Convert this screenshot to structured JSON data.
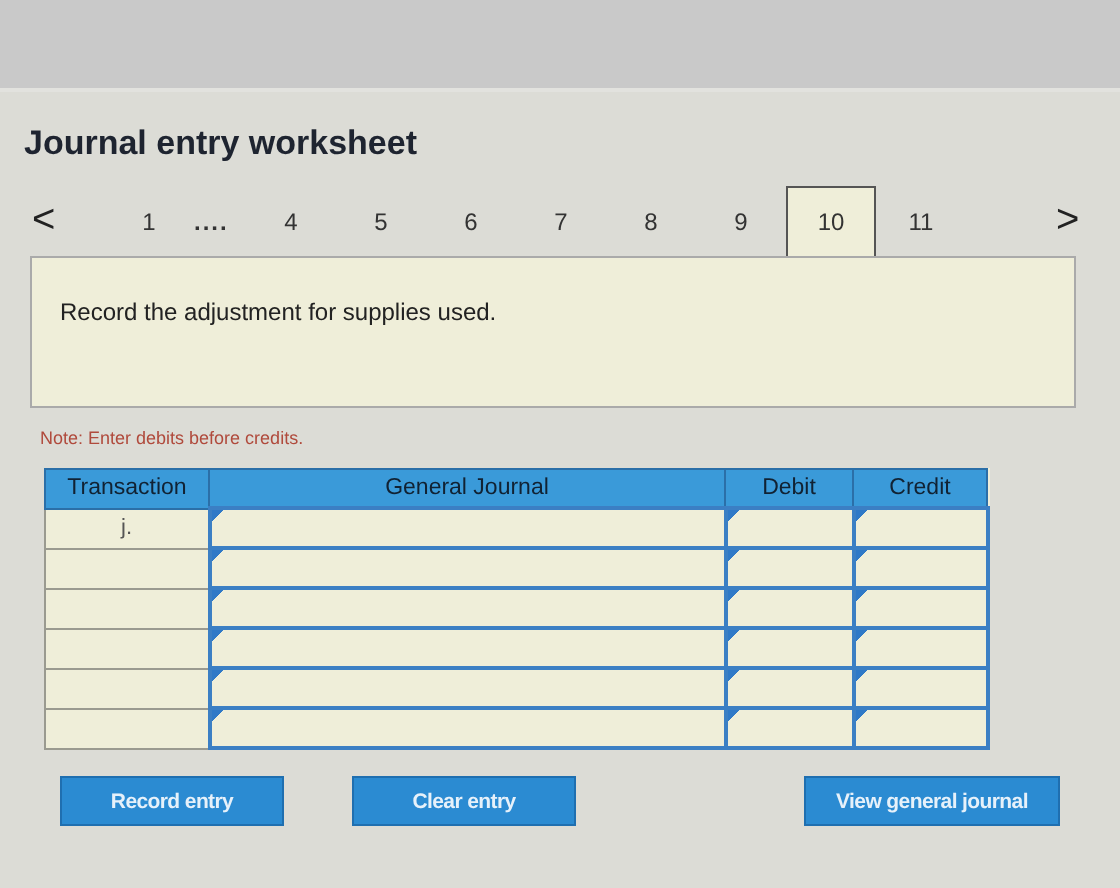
{
  "title": "Journal entry worksheet",
  "nav": {
    "prev": "<",
    "next": ">"
  },
  "tabs": [
    {
      "kind": "tab",
      "label": "1",
      "selected": false
    },
    {
      "kind": "ellipsis",
      "label": "....",
      "selected": false
    },
    {
      "kind": "tab",
      "label": "4",
      "selected": false
    },
    {
      "kind": "tab",
      "label": "5",
      "selected": false
    },
    {
      "kind": "tab",
      "label": "6",
      "selected": false
    },
    {
      "kind": "tab",
      "label": "7",
      "selected": false
    },
    {
      "kind": "tab",
      "label": "8",
      "selected": false
    },
    {
      "kind": "tab",
      "label": "9",
      "selected": false
    },
    {
      "kind": "tab",
      "label": "10",
      "selected": true
    },
    {
      "kind": "tab",
      "label": "11",
      "selected": false
    }
  ],
  "instruction": "Record the adjustment for supplies used.",
  "note": "Note: Enter debits before credits.",
  "table": {
    "columns": [
      "Transaction",
      "General Journal",
      "Debit",
      "Credit"
    ],
    "rows": [
      {
        "transaction": "j."
      },
      {},
      {},
      {},
      {},
      {}
    ]
  },
  "buttons": [
    "Record entry",
    "Clear entry",
    "View general journal"
  ]
}
